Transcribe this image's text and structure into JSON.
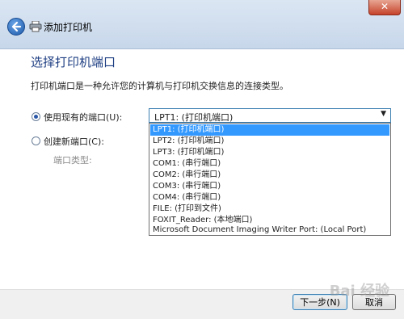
{
  "window": {
    "title": "添加打印机",
    "close_glyph": "✕"
  },
  "page": {
    "heading": "选择打印机端口",
    "description": "打印机端口是一种允许您的计算机与打印机交换信息的连接类型。"
  },
  "options": {
    "use_existing_label": "使用现有的端口(U):",
    "create_new_label": "创建新端口(C):",
    "port_type_label": "端口类型:"
  },
  "combo": {
    "selected_value": "LPT1: (打印机端口)",
    "arrow_glyph": "▼"
  },
  "dropdown": {
    "items": [
      "LPT1: (打印机端口)",
      "LPT2: (打印机端口)",
      "LPT3: (打印机端口)",
      "COM1: (串行端口)",
      "COM2: (串行端口)",
      "COM3: (串行端口)",
      "COM4: (串行端口)",
      "FILE: (打印到文件)",
      "FOXIT_Reader: (本地端口)",
      "Microsoft Document Imaging Writer Port: (Local Port)"
    ]
  },
  "buttons": {
    "next": "下一步(N)",
    "cancel": "取消"
  },
  "watermark": {
    "text": "Bai 经验"
  },
  "icons": {
    "back": "back-arrow-icon",
    "printer": "printer-icon",
    "close": "close-icon"
  }
}
